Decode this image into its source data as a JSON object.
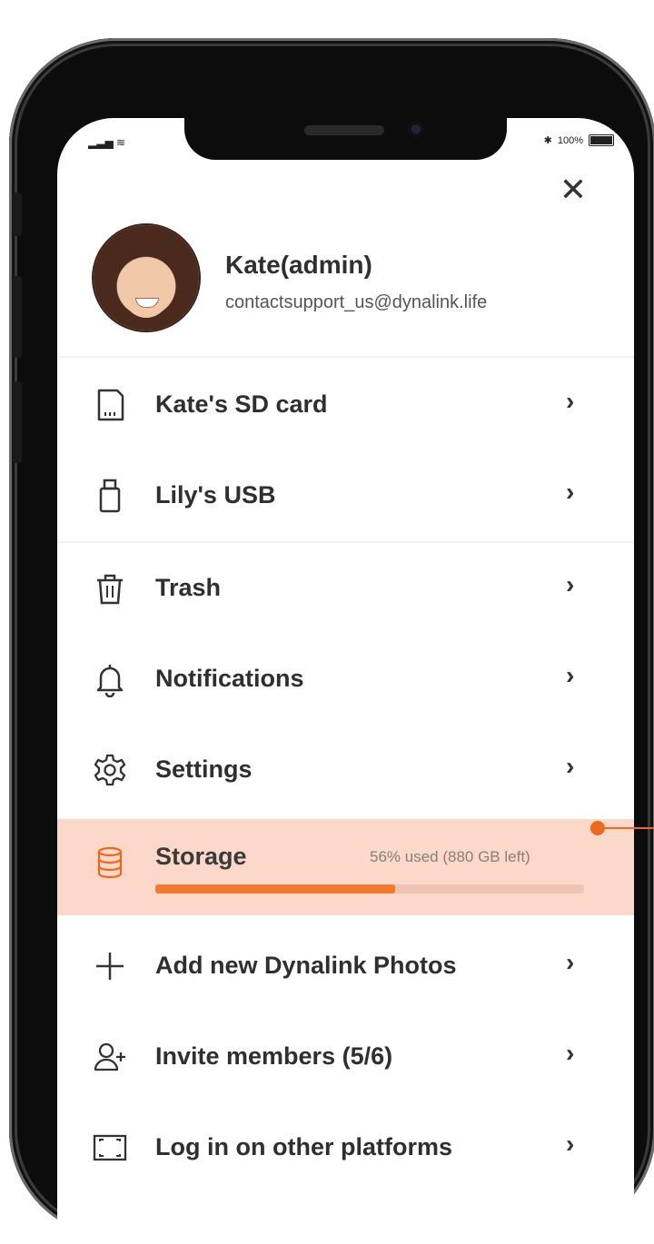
{
  "status": {
    "battery": "100%"
  },
  "profile": {
    "name": "Kate(admin)",
    "email": "contactsupport_us@dynalink.life"
  },
  "menu": {
    "sd_card": "Kate's SD card",
    "usb": "Lily's USB",
    "trash": "Trash",
    "notifications": "Notifications",
    "settings": "Settings",
    "storage": "Storage",
    "storage_meta": "56% used (880 GB left)",
    "storage_used_fraction": 0.56,
    "add_photos": "Add new Dynalink Photos",
    "invite": "Invite members (5/6)",
    "login_other": "Log in on other platforms"
  },
  "colors": {
    "accent": "#f07a32",
    "storage_highlight": "#fbd8c9",
    "text": "#2f2f2f"
  }
}
